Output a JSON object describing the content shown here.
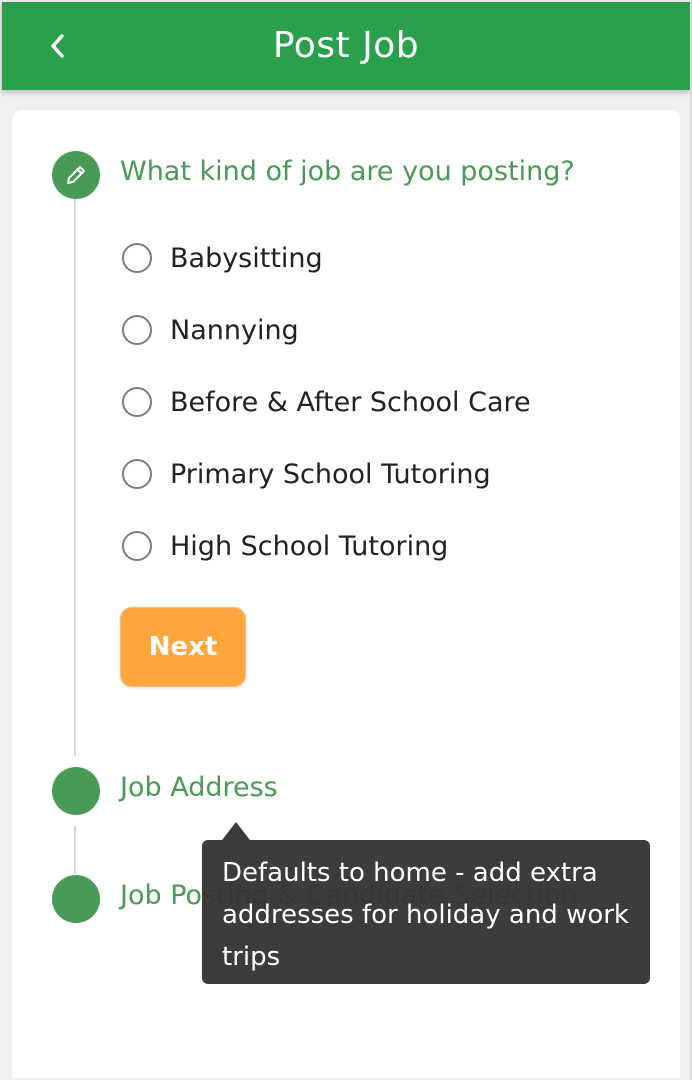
{
  "header": {
    "title": "Post Job",
    "back_icon": "chevron-left-icon"
  },
  "steps": [
    {
      "title": "What kind of job are you posting?",
      "icon": "pencil-icon",
      "status": "active",
      "options": [
        {
          "label": "Babysitting",
          "selected": false
        },
        {
          "label": "Nannying",
          "selected": false
        },
        {
          "label": "Before & After School Care",
          "selected": false
        },
        {
          "label": "Primary School Tutoring",
          "selected": false
        },
        {
          "label": "High School Tutoring",
          "selected": false
        }
      ],
      "next_label": "Next"
    },
    {
      "title": "Job Address",
      "status": "pending"
    },
    {
      "title": "Job Posting & Candidate Selection",
      "status": "pending"
    }
  ],
  "tooltip": {
    "text": "Defaults to home - add extra addresses for holiday and work trips"
  },
  "colors": {
    "header_green": "#2aa04c",
    "step_green": "#4a9a57",
    "next_orange": "#ffa63f",
    "tooltip_bg": "#343434"
  }
}
